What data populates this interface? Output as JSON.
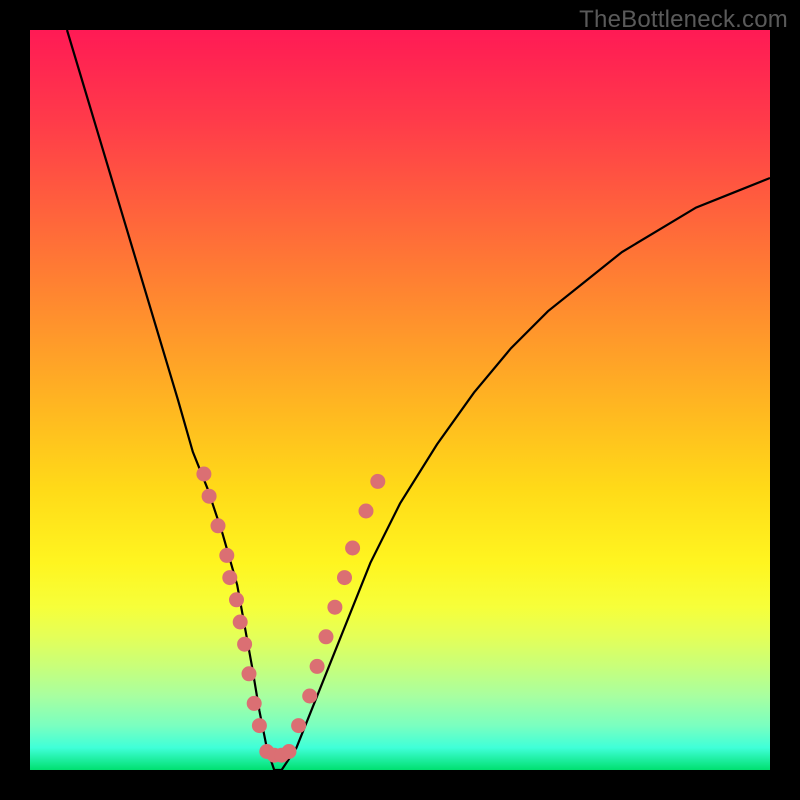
{
  "watermark": "TheBottleneck.com",
  "colors": {
    "gradient_top": "#ff1a55",
    "gradient_mid": "#ffda18",
    "gradient_bottom": "#00e070",
    "curve": "#000000",
    "dots": "#db6f73",
    "frame": "#000000"
  },
  "chart_data": {
    "type": "line",
    "title": "",
    "xlabel": "",
    "ylabel": "",
    "xlim": [
      0,
      100
    ],
    "ylim": [
      0,
      100
    ],
    "grid": false,
    "legend": false,
    "series": [
      {
        "name": "curve",
        "x": [
          5,
          8,
          11,
          14,
          17,
          20,
          22,
          24,
          26,
          28,
          30,
          31,
          32,
          33,
          34,
          36,
          38,
          42,
          46,
          50,
          55,
          60,
          65,
          70,
          75,
          80,
          85,
          90,
          95,
          100
        ],
        "y": [
          100,
          90,
          80,
          70,
          60,
          50,
          43,
          38,
          32,
          25,
          14,
          8,
          3,
          0,
          0,
          3,
          8,
          18,
          28,
          36,
          44,
          51,
          57,
          62,
          66,
          70,
          73,
          76,
          78,
          80
        ]
      }
    ],
    "markers": [
      {
        "x": 23.5,
        "y": 40
      },
      {
        "x": 24.2,
        "y": 37
      },
      {
        "x": 25.4,
        "y": 33
      },
      {
        "x": 26.6,
        "y": 29
      },
      {
        "x": 27.0,
        "y": 26
      },
      {
        "x": 27.9,
        "y": 23
      },
      {
        "x": 28.4,
        "y": 20
      },
      {
        "x": 29.0,
        "y": 17
      },
      {
        "x": 29.6,
        "y": 13
      },
      {
        "x": 30.3,
        "y": 9
      },
      {
        "x": 31.0,
        "y": 6
      },
      {
        "x": 32.0,
        "y": 2.5
      },
      {
        "x": 33.0,
        "y": 2.0
      },
      {
        "x": 34.0,
        "y": 2.0
      },
      {
        "x": 35.0,
        "y": 2.5
      },
      {
        "x": 36.3,
        "y": 6
      },
      {
        "x": 37.8,
        "y": 10
      },
      {
        "x": 38.8,
        "y": 14
      },
      {
        "x": 40.0,
        "y": 18
      },
      {
        "x": 41.2,
        "y": 22
      },
      {
        "x": 42.5,
        "y": 26
      },
      {
        "x": 43.6,
        "y": 30
      },
      {
        "x": 45.4,
        "y": 35
      },
      {
        "x": 47.0,
        "y": 39
      }
    ]
  }
}
